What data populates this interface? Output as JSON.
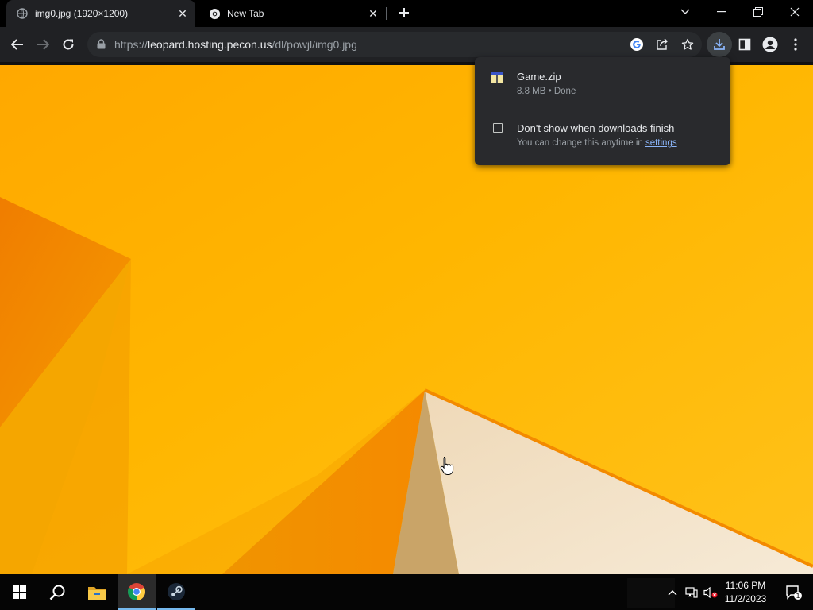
{
  "browser": {
    "tabs": [
      {
        "title": "img0.jpg (1920×1200)",
        "active": true
      },
      {
        "title": "New Tab",
        "active": false
      }
    ],
    "url": {
      "scheme": "https://",
      "host": "leopard.hosting.pecon.us",
      "path": "/dl/powjl/img0.jpg"
    }
  },
  "downloads_bubble": {
    "file_name": "Game.zip",
    "file_meta": "8.8 MB • Done",
    "checkbox_label": "Don't show when downloads finish",
    "checkbox_checked": false,
    "hint_prefix": "You can change this anytime in",
    "hint_link": "settings"
  },
  "taskbar": {
    "apps": [
      "start-icon",
      "search-icon",
      "file-explorer-icon",
      "chrome-icon",
      "steam-icon"
    ],
    "clock_time": "11:06 PM",
    "clock_date": "11/2/2023",
    "notification_count": "1"
  },
  "colors": {
    "wallpaper_base": "#ffb300",
    "wallpaper_orange": "#f08c00",
    "wallpaper_cream": "#f3e2c8",
    "accent_link": "#8ab4f8",
    "taskbar_underline": "#76b9ed"
  }
}
